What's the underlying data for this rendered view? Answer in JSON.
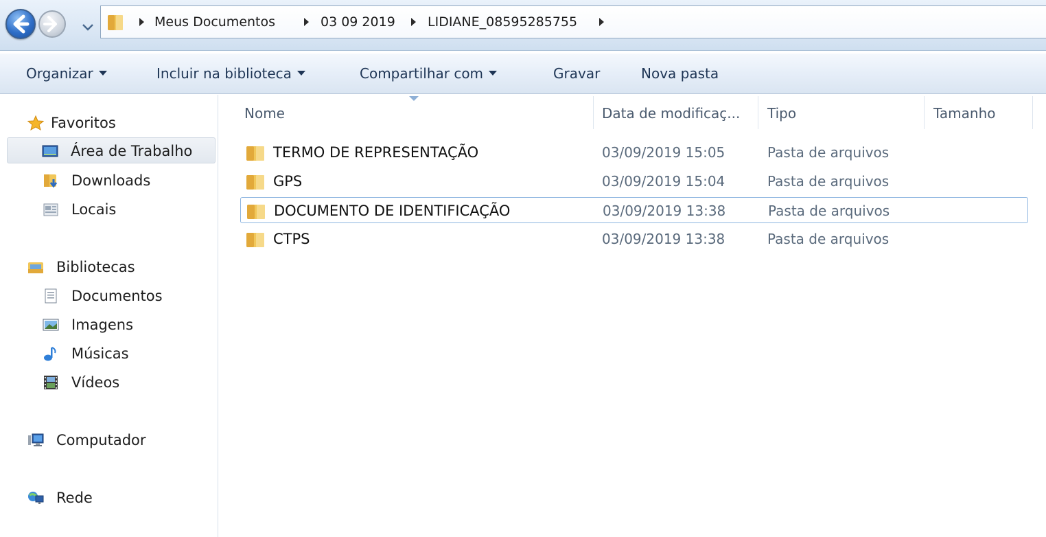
{
  "address": {
    "crumbs": [
      "Meus Documentos",
      "03 09 2019",
      "LIDIANE_08595285755"
    ]
  },
  "toolbar": {
    "organize": "Organizar",
    "include_library": "Incluir na biblioteca",
    "share_with": "Compartilhar com",
    "burn": "Gravar",
    "new_folder": "Nova pasta"
  },
  "nav": {
    "favorites": "Favoritos",
    "desktop": "Área de Trabalho",
    "downloads": "Downloads",
    "recent_places": "Locais",
    "libraries": "Bibliotecas",
    "documents": "Documentos",
    "pictures": "Imagens",
    "music": "Músicas",
    "videos": "Vídeos",
    "computer": "Computador",
    "network": "Rede"
  },
  "columns": {
    "name": "Nome",
    "date": "Data de modificaç...",
    "type": "Tipo",
    "size": "Tamanho"
  },
  "files": [
    {
      "name": "TERMO DE REPRESENTAÇÃO",
      "date": "03/09/2019 15:05",
      "type": "Pasta de arquivos"
    },
    {
      "name": "GPS",
      "date": "03/09/2019 15:04",
      "type": "Pasta de arquivos"
    },
    {
      "name": "DOCUMENTO DE IDENTIFICAÇÃO",
      "date": "03/09/2019 13:38",
      "type": "Pasta de arquivos"
    },
    {
      "name": "CTPS",
      "date": "03/09/2019 13:38",
      "type": "Pasta de arquivos"
    }
  ],
  "colors": {
    "accent": "#2f6fc8",
    "selection_border": "#8cb4e0",
    "folder": "#e8b84a"
  }
}
